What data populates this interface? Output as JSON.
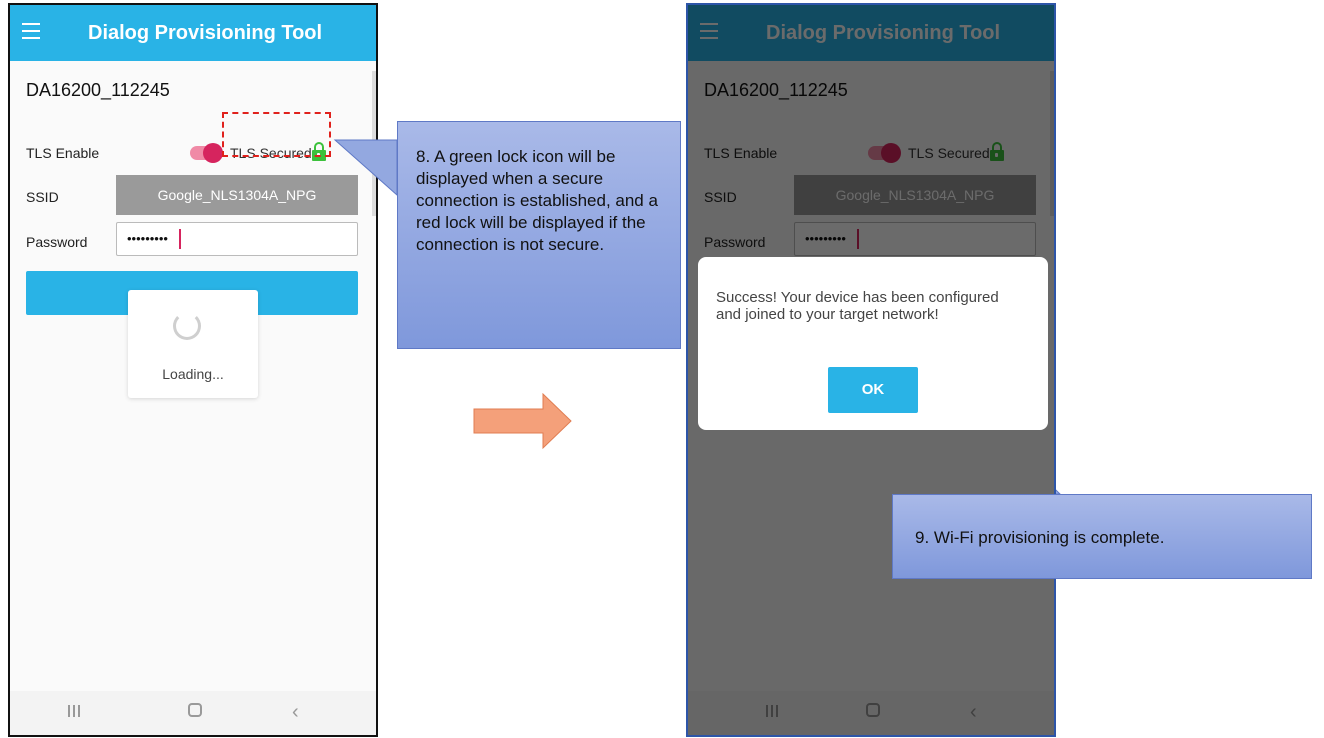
{
  "app_title": "Dialog Provisioning Tool",
  "device_name": "DA16200_112245",
  "tls_label": "TLS Enable",
  "tls_secured_text": "TLS Secured",
  "ssid_label": "SSID",
  "ssid_value": "Google_NLS1304A_NPG",
  "password_label": "Password",
  "password_mask": "•••••••••",
  "loading_text": "Loading...",
  "dialog": {
    "message": "Success! Your device has been configured and joined to your target network!",
    "ok_label": "OK"
  },
  "callouts": {
    "step8": "8. A green lock icon will be displayed when a secure connection is established, and a red lock will be displayed if the connection is not secure.",
    "step9": "9. Wi-Fi provisioning is complete."
  },
  "icons": {
    "menu": "hamburger-icon",
    "lock": "green-lock-icon",
    "loading": "refresh-spinner-icon",
    "arrow": "right-arrow-icon",
    "nav": [
      "recents-icon",
      "home-icon",
      "back-icon"
    ]
  },
  "colors": {
    "appbar": "#29b3e6",
    "toggle": "#d6245e",
    "lock": "#3cc13c",
    "callout": "#8da3df",
    "arrow": "#f4a07a",
    "highlight": "#e0211c"
  }
}
